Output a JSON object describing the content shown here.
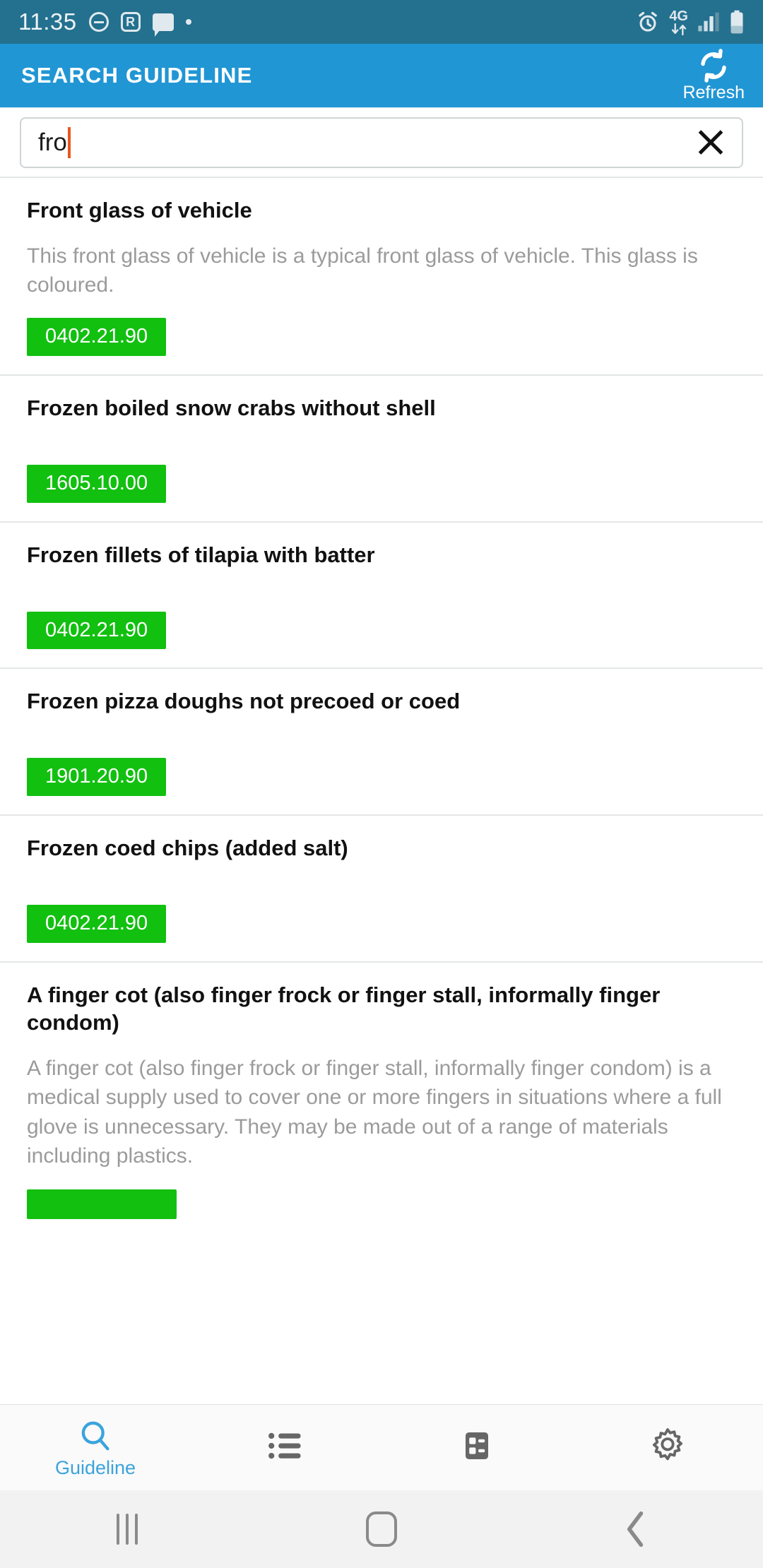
{
  "status_bar": {
    "time": "11:35",
    "left_icons": [
      "dnd-icon",
      "r-badge-icon",
      "message-icon",
      "dot-icon"
    ],
    "r_badge_letter": "R",
    "network_label": "4G",
    "right_icons": [
      "alarm-icon",
      "mobile-data-icon",
      "signal-icon",
      "battery-icon"
    ],
    "background_color": "#24708f"
  },
  "app_bar": {
    "title": "SEARCH GUIDELINE",
    "refresh_label": "Refresh",
    "refresh_icon": "refresh-icon",
    "background_color": "#2196d4"
  },
  "search": {
    "value": "fro",
    "placeholder": "",
    "clear_icon": "close-icon",
    "caret_color": "#e8581f"
  },
  "results": [
    {
      "title": "Front glass of vehicle",
      "description": "This front glass of vehicle is a typical front glass of vehicle. This glass is coloured.",
      "code": "0402.21.90"
    },
    {
      "title": "Frozen boiled snow crabs without shell",
      "description": "",
      "code": "1605.10.00"
    },
    {
      "title": "Frozen fillets of tilapia with batter",
      "description": "",
      "code": "0402.21.90"
    },
    {
      "title": "Frozen pizza doughs not precoed or coed",
      "description": "",
      "code": "1901.20.90"
    },
    {
      "title": "Frozen coed chips (added salt)",
      "description": "",
      "code": "0402.21.90"
    },
    {
      "title": "A finger cot (also finger frock or finger stall, informally finger condom)",
      "description": "A finger cot (also finger frock or finger stall, informally finger condom) is a medical supply used to cover one or more fingers in situations where a full glove is unnecessary. They may be made out of a range of materials including plastics.",
      "code": ""
    }
  ],
  "code_badge_color": "#12c010",
  "tab_bar": {
    "tabs": [
      {
        "icon": "search-icon",
        "label": "Guideline",
        "active": true
      },
      {
        "icon": "list-bullet-icon",
        "label": "",
        "active": false
      },
      {
        "icon": "list-box-icon",
        "label": "",
        "active": false
      },
      {
        "icon": "gear-icon",
        "label": "",
        "active": false
      }
    ],
    "active_color": "#3ba3dd",
    "inactive_color": "#666666"
  },
  "android_nav": {
    "recents_icon": "recents-icon",
    "home_icon": "home-icon",
    "back_icon": "back-icon"
  }
}
